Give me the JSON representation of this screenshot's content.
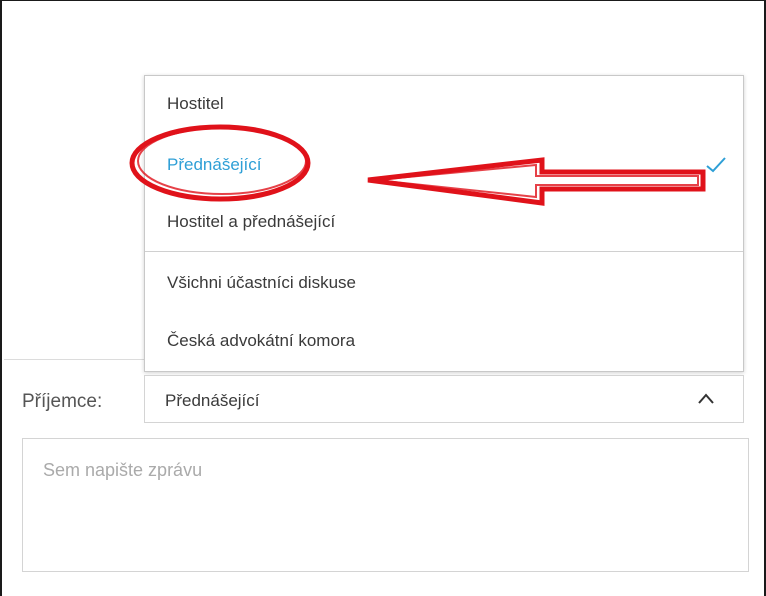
{
  "dropdown": {
    "options": [
      {
        "label": "Hostitel",
        "selected": false
      },
      {
        "label": "Přednášející",
        "selected": true
      },
      {
        "label": "Hostitel a přednášející",
        "selected": false
      },
      {
        "label": "Všichni účastníci diskuse",
        "selected": false
      },
      {
        "label": "Česká advokátní komora",
        "selected": false
      }
    ]
  },
  "recipient": {
    "label": "Příjemce:",
    "value": "Přednášející"
  },
  "message": {
    "placeholder": "Sem napište zprávu"
  },
  "colors": {
    "selected_option": "#2e9fd6",
    "annotation_red": "#e0121a"
  },
  "icons": {
    "selected_check": "check-icon",
    "select_toggle": "chevron-up-icon"
  }
}
